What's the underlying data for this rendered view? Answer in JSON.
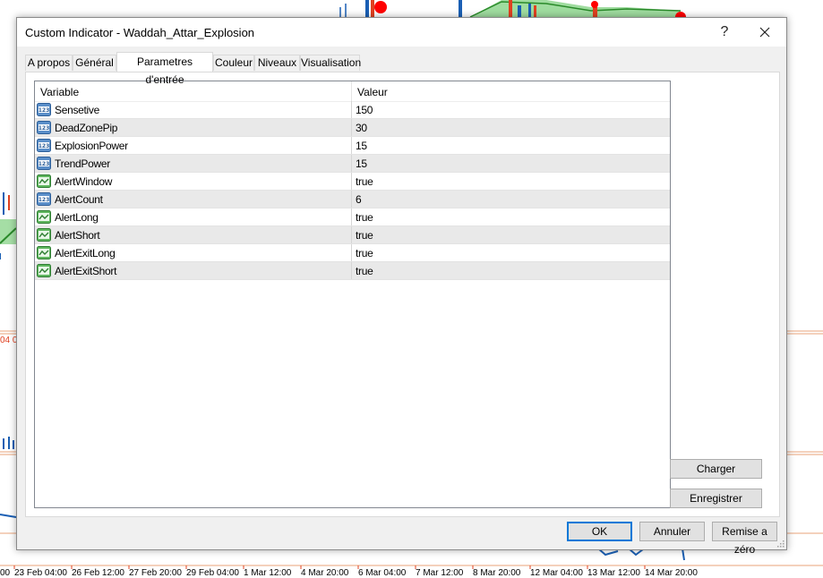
{
  "window": {
    "title": "Custom Indicator - Waddah_Attar_Explosion",
    "help_label": "?",
    "close_label": "✕"
  },
  "tabs": [
    {
      "label": "A propos",
      "active": false
    },
    {
      "label": "Général",
      "active": false
    },
    {
      "label": "Parametres d'entrée",
      "active": true
    },
    {
      "label": "Couleur",
      "active": false
    },
    {
      "label": "Niveaux",
      "active": false
    },
    {
      "label": "Visualisation",
      "active": false
    }
  ],
  "grid": {
    "columns": [
      "Variable",
      "Valeur"
    ],
    "rows": [
      {
        "name": "Sensetive",
        "value": "150",
        "icon": "numeric-123-icon"
      },
      {
        "name": "DeadZonePip",
        "value": "30",
        "icon": "numeric-123-icon"
      },
      {
        "name": "ExplosionPower",
        "value": "15",
        "icon": "numeric-123-icon"
      },
      {
        "name": "TrendPower",
        "value": "15",
        "icon": "numeric-123-icon"
      },
      {
        "name": "AlertWindow",
        "value": "true",
        "icon": "boolean-chart-icon"
      },
      {
        "name": "AlertCount",
        "value": "6",
        "icon": "numeric-123-icon"
      },
      {
        "name": "AlertLong",
        "value": "true",
        "icon": "boolean-chart-icon"
      },
      {
        "name": "AlertShort",
        "value": "true",
        "icon": "boolean-chart-icon"
      },
      {
        "name": "AlertExitLong",
        "value": "true",
        "icon": "boolean-chart-icon"
      },
      {
        "name": "AlertExitShort",
        "value": "true",
        "icon": "boolean-chart-icon"
      }
    ]
  },
  "side_buttons": {
    "load_label": "Charger",
    "save_label": "Enregistrer"
  },
  "footer_buttons": {
    "ok_label": "OK",
    "cancel_label": "Annuler",
    "reset_label": "Remise a zéro"
  },
  "background_chart": {
    "date_labels": [
      "00",
      "23 Feb 04:00",
      "26 Feb 12:00",
      "27 Feb 20:00",
      "29 Feb 04:00",
      "1 Mar 12:00",
      "4 Mar 20:00",
      "6 Mar 04:00",
      "7 Mar 12:00",
      "8 Mar 20:00",
      "12 Mar 04:00",
      "13 Mar 12:00",
      "14 Mar 20:00"
    ],
    "side_label": "04 0",
    "colors": {
      "axis": "#e8a37a",
      "bull": "#1a5fb4",
      "bear": "#e04020",
      "histogram": "#7fd07f",
      "signal": "#ff0000"
    }
  }
}
